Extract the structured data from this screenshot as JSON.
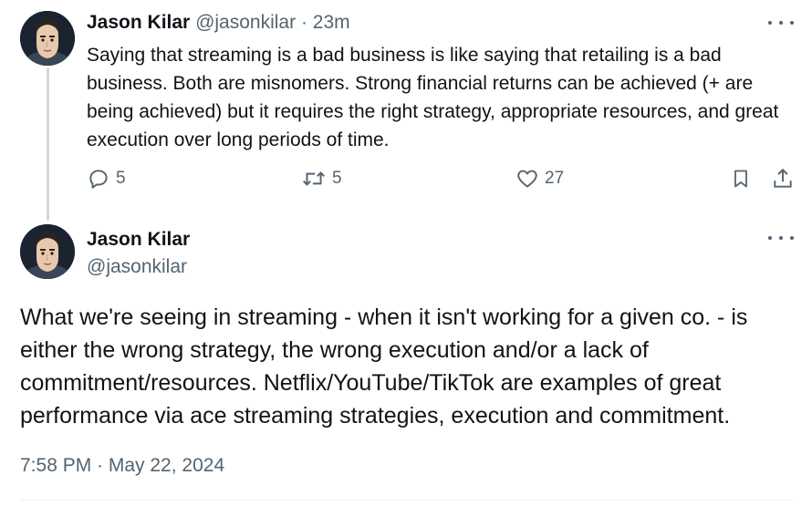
{
  "tweet1": {
    "author_name": "Jason Kilar",
    "author_handle": "@jasonkilar",
    "separator": "·",
    "time_ago": "23m",
    "text": "Saying that streaming is a bad business is like saying that retailing is a bad business. Both are misnomers. Strong financial returns can be achieved (+ are being achieved) but it requires the right strategy, appropriate resources, and great execution over long periods of time.",
    "actions": {
      "replies": "5",
      "reposts": "5",
      "likes": "27"
    },
    "icons": [
      "reply-icon",
      "repost-icon",
      "like-icon",
      "bookmark-icon",
      "share-icon",
      "more-icon"
    ]
  },
  "tweet2": {
    "author_name": "Jason Kilar",
    "author_handle": "@jasonkilar",
    "text": "What we're seeing in streaming - when it isn't working for a given co. - is either the wrong strategy, the wrong execution and/or a lack of commitment/resources. Netflix/YouTube/TikTok are examples of great performance via ace streaming strategies, execution and commitment.",
    "timestamp": "7:58 PM · May 22, 2024"
  },
  "colors": {
    "text_primary": "#0f1419",
    "text_secondary": "#536471",
    "thread_line": "#cfd9de",
    "divider": "#eff3f4"
  }
}
